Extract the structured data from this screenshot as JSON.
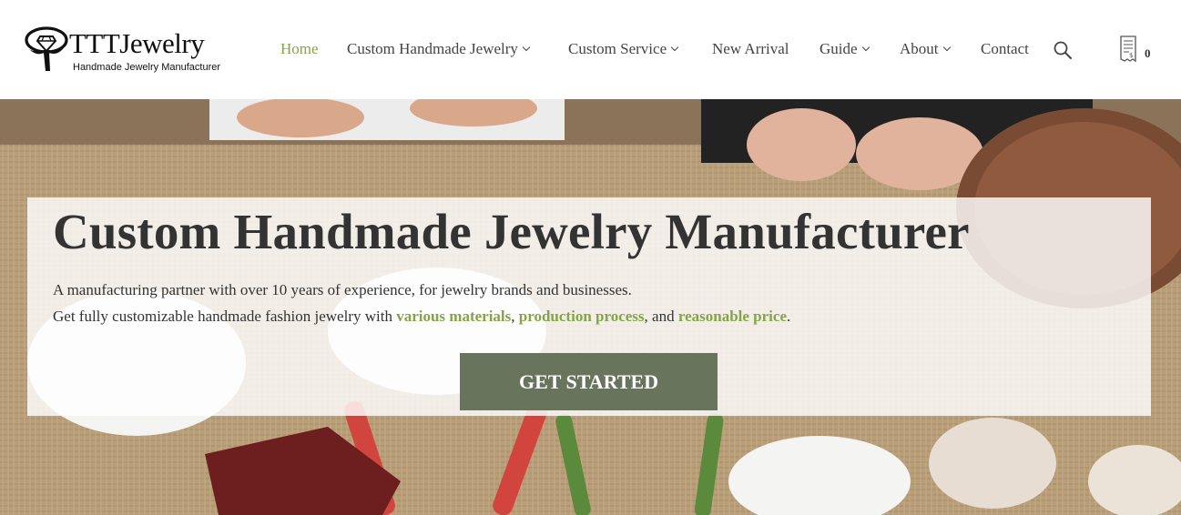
{
  "brand": {
    "name": "TTTJewelry",
    "tagline": "Handmade Jewelry Manufacturer"
  },
  "nav": {
    "items": [
      {
        "label": "Home",
        "active": true,
        "dropdown": false
      },
      {
        "label": "Custom Handmade Jewelry",
        "active": false,
        "dropdown": true
      },
      {
        "label": "Custom Service",
        "active": false,
        "dropdown": true
      },
      {
        "label": "New Arrival",
        "active": false,
        "dropdown": false
      },
      {
        "label": "Guide",
        "active": false,
        "dropdown": true
      },
      {
        "label": "About",
        "active": false,
        "dropdown": true
      },
      {
        "label": "Contact",
        "active": false,
        "dropdown": false
      }
    ],
    "search_icon": "search-icon",
    "cart_icon": "quote-list-icon",
    "cart_count": "0"
  },
  "hero": {
    "title": "Custom Handmade Jewelry Manufacturer",
    "line1": "A manufacturing partner with over 10 years of experience, for jewelry brands and businesses.",
    "line2_prefix": "Get fully customizable handmade fashion jewelry with ",
    "highlight1": "various materials",
    "sep1": ", ",
    "highlight2": "production process",
    "sep2": ", and ",
    "highlight3": "reasonable price",
    "line2_suffix": ".",
    "cta_label": "GET STARTED"
  },
  "colors": {
    "accent_green": "#84a447",
    "cta_background": "#69745d",
    "text_dark": "#333333",
    "nav_text": "#444444"
  }
}
